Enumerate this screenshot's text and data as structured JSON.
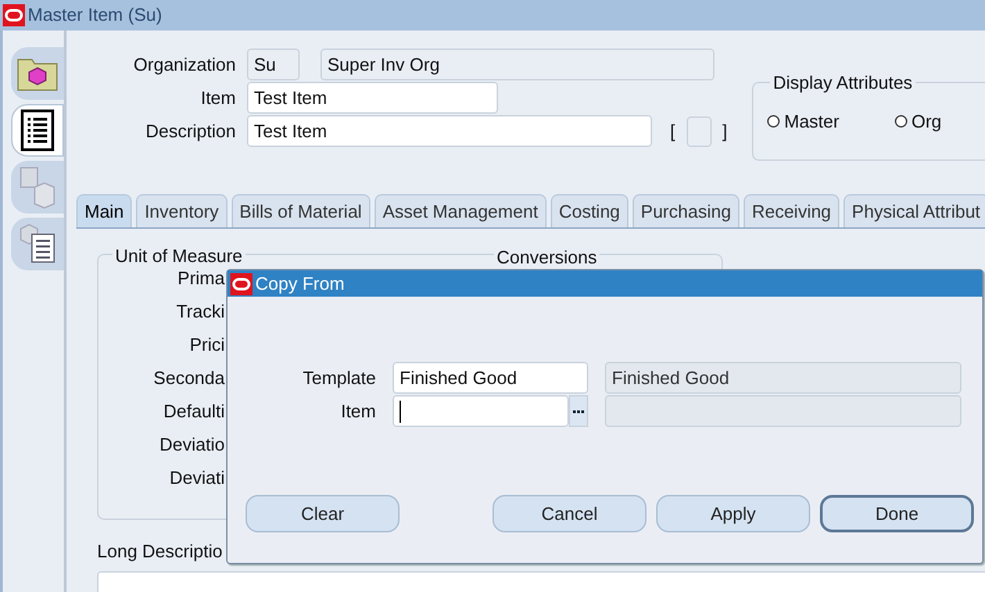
{
  "window": {
    "title": "Master Item (Su)"
  },
  "side_tabs": [
    {
      "kind": "folder",
      "selected": false
    },
    {
      "kind": "list",
      "selected": true
    },
    {
      "kind": "building",
      "selected": false
    },
    {
      "kind": "box-list",
      "selected": false
    }
  ],
  "header": {
    "organization": {
      "label": "Organization",
      "code": "Su",
      "name": "Super Inv Org"
    },
    "item": {
      "label": "Item",
      "value": "Test Item"
    },
    "description": {
      "label": "Description",
      "value": "Test Item"
    },
    "flex_open": "[",
    "flex_close": "]"
  },
  "display_attributes": {
    "title": "Display Attributes",
    "options": [
      {
        "label": "Master",
        "selected": false
      },
      {
        "label": "Org",
        "selected": false
      }
    ]
  },
  "tabs": [
    {
      "label": "Main",
      "selected": true
    },
    {
      "label": "Inventory",
      "selected": false
    },
    {
      "label": "Bills of Material",
      "selected": false
    },
    {
      "label": "Asset Management",
      "selected": false
    },
    {
      "label": "Costing",
      "selected": false
    },
    {
      "label": "Purchasing",
      "selected": false
    },
    {
      "label": "Receiving",
      "selected": false
    },
    {
      "label": "Physical Attribut",
      "selected": false
    }
  ],
  "unit_of_measure": {
    "title": "Unit of Measure",
    "labels": [
      "Prima",
      "Tracki",
      "Prici",
      "Seconda",
      "Defaulti",
      "Deviatio",
      "Deviati"
    ]
  },
  "conversions": {
    "title": "Conversions"
  },
  "long_description": {
    "label": "Long Descriptio"
  },
  "dialog": {
    "title": "Copy From",
    "fields": [
      {
        "label": "Template",
        "value": "Finished Good",
        "description": "Finished Good",
        "lov": false,
        "focused": false
      },
      {
        "label": "Item",
        "lov": true,
        "focused": true
      }
    ],
    "buttons": [
      {
        "label": "Clear",
        "default": false
      },
      {
        "label": "Cancel",
        "default": false
      },
      {
        "label": "Apply",
        "default": false
      },
      {
        "label": "Done",
        "default": true
      }
    ]
  }
}
